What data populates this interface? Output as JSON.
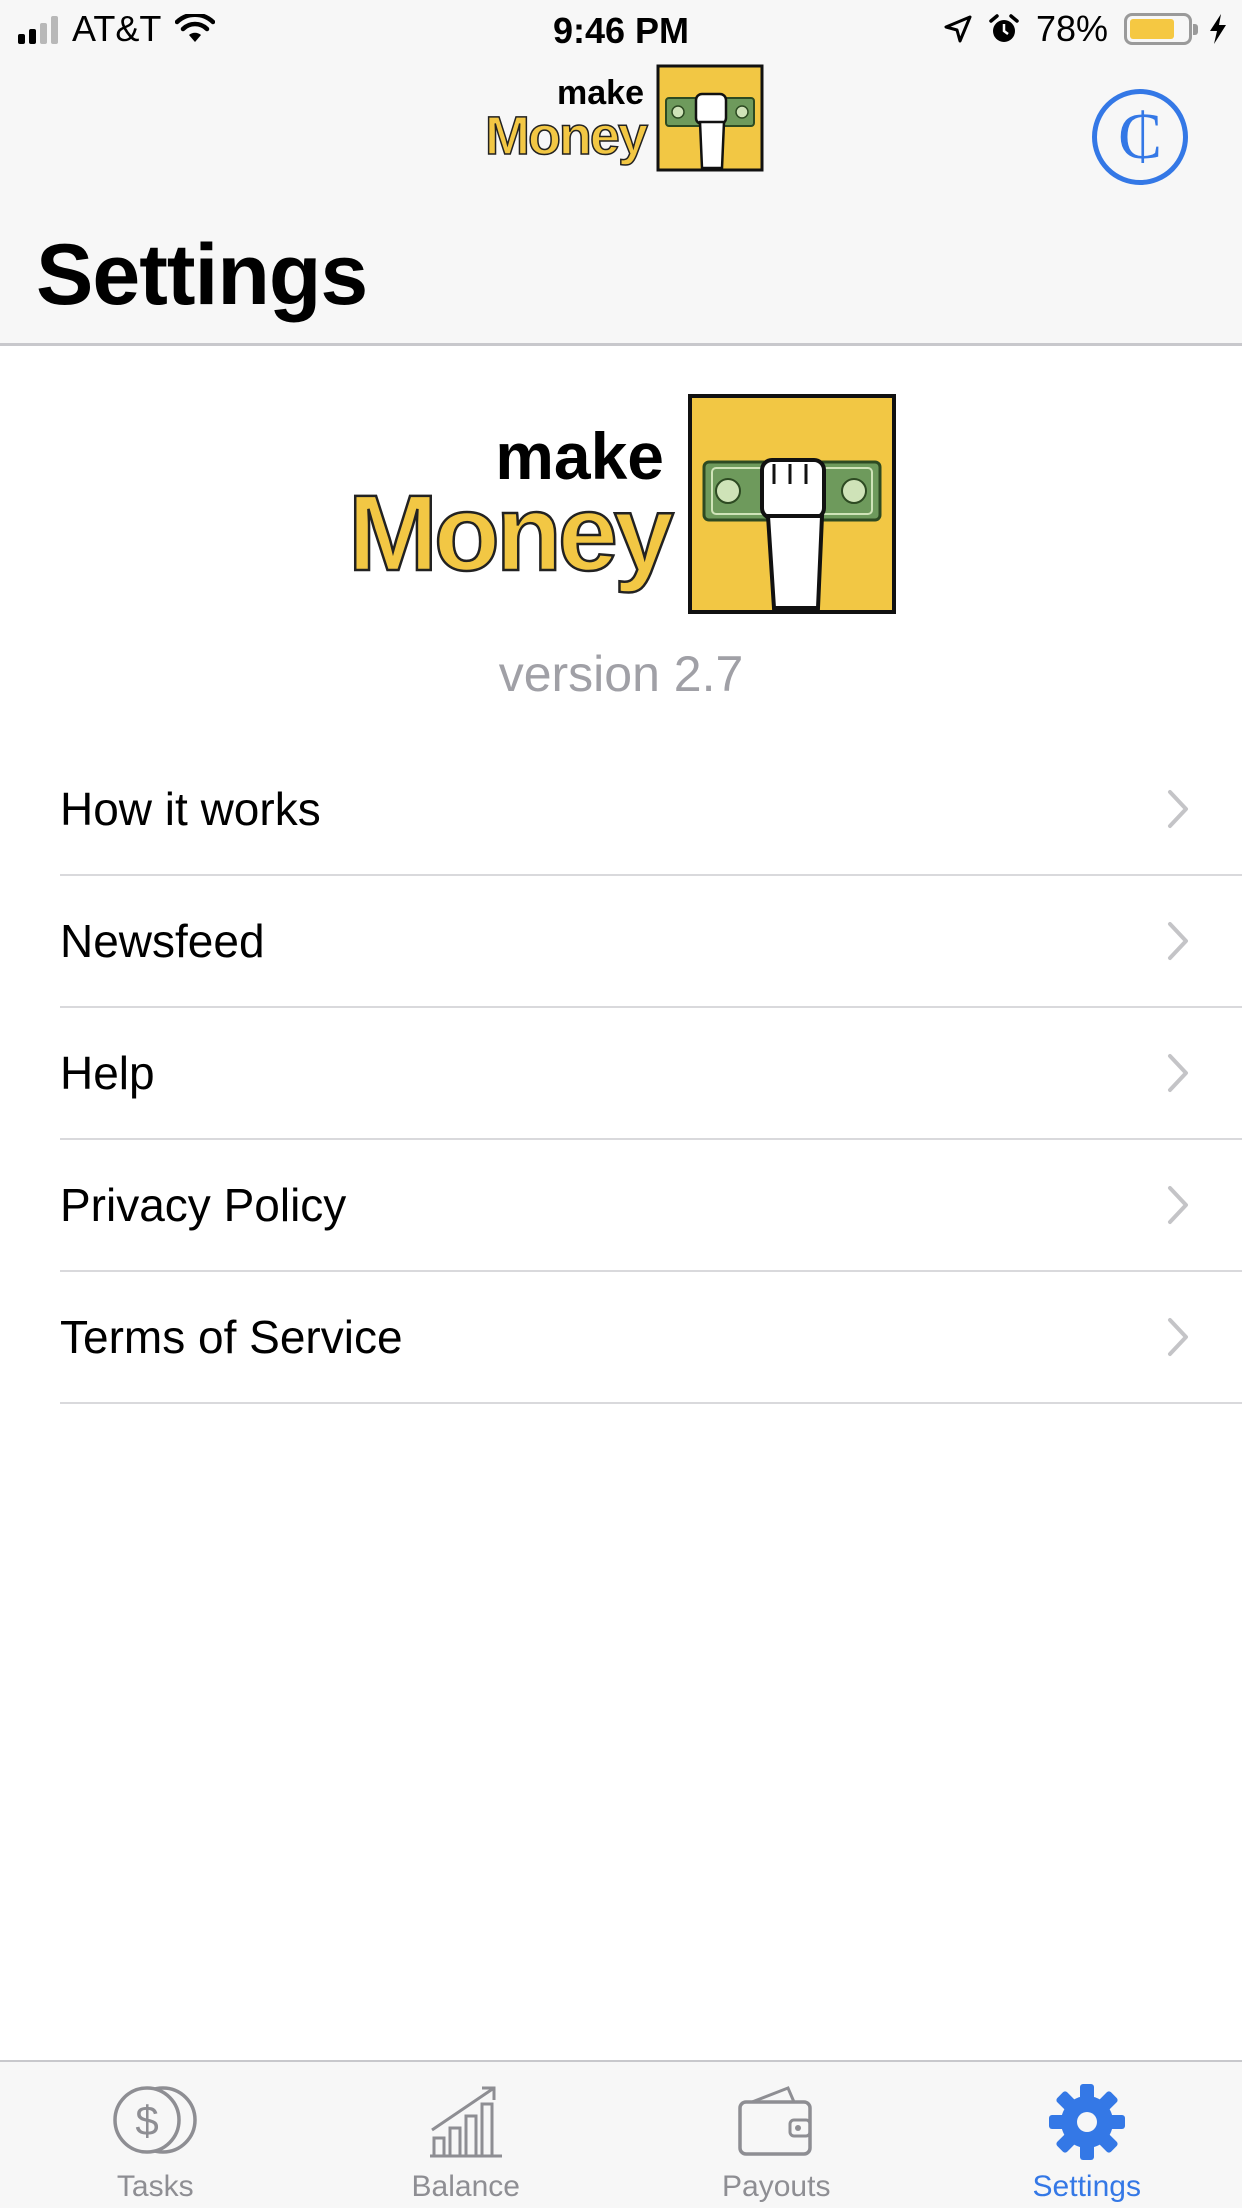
{
  "status_bar": {
    "carrier": "AT&T",
    "time": "9:46 PM",
    "battery_percent": "78%",
    "battery_level": 0.78
  },
  "header": {
    "logo": {
      "line1": "make",
      "line2": "Money"
    },
    "coin_symbol": "₵",
    "title": "Settings"
  },
  "brand": {
    "logo": {
      "line1": "make",
      "line2": "Money"
    },
    "version": "version 2.7"
  },
  "menu": {
    "items": [
      {
        "label": "How it works"
      },
      {
        "label": "Newsfeed"
      },
      {
        "label": "Help"
      },
      {
        "label": "Privacy Policy"
      },
      {
        "label": "Terms of Service"
      }
    ]
  },
  "tab_bar": {
    "tabs": [
      {
        "label": "Tasks",
        "icon": "coins-icon",
        "active": false
      },
      {
        "label": "Balance",
        "icon": "bar-chart-icon",
        "active": false
      },
      {
        "label": "Payouts",
        "icon": "wallet-icon",
        "active": false
      },
      {
        "label": "Settings",
        "icon": "gear-icon",
        "active": true
      }
    ]
  },
  "colors": {
    "accent": "#3478e6",
    "brand_yellow": "#f2c744",
    "inactive": "#8e8e93",
    "secondary_text": "#a0a0a6"
  }
}
